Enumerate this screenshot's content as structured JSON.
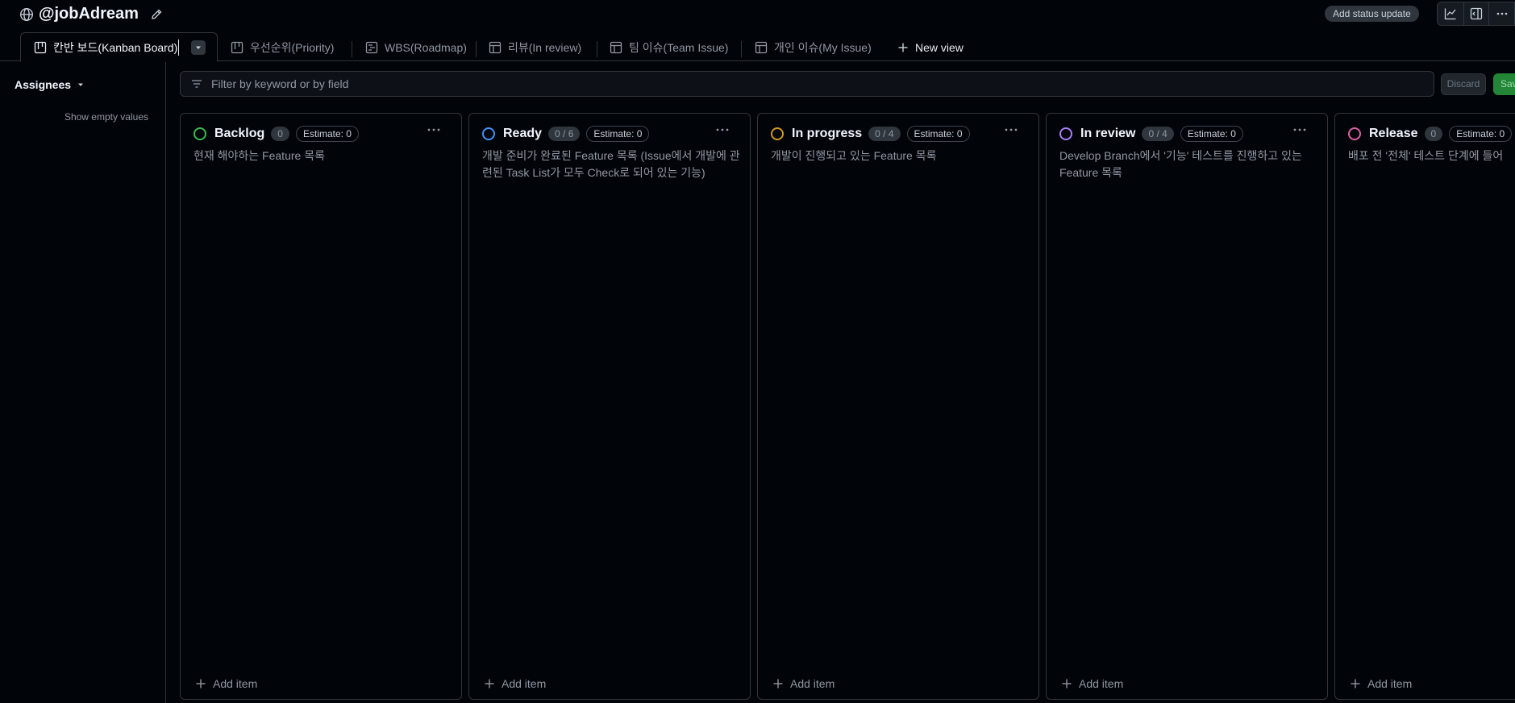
{
  "project": {
    "title": "@jobAdream"
  },
  "header": {
    "status_label": "Add status update"
  },
  "tabs": [
    {
      "label": "칸반 보드(Kanban Board)",
      "active": true,
      "icon": "board-icon"
    },
    {
      "label": "우선순위(Priority)",
      "icon": "board-icon"
    },
    {
      "label": "WBS(Roadmap)",
      "icon": "roadmap-icon"
    },
    {
      "label": "리뷰(In review)",
      "icon": "table-icon"
    },
    {
      "label": "팀 이슈(Team Issue)",
      "icon": "table-icon"
    },
    {
      "label": "개인 이슈(My Issue)",
      "icon": "table-icon"
    }
  ],
  "new_view_label": "New view",
  "sidebar": {
    "group_by": "Assignees",
    "empty_toggle": "Show empty values"
  },
  "filter": {
    "placeholder": "Filter by keyword or by field",
    "discard_label": "Discard",
    "save_label": "Save"
  },
  "columns": [
    {
      "title": "Backlog",
      "count": "0",
      "estimate": "Estimate: 0",
      "color": "#3fb950",
      "description": "현재 해야하는 Feature 목록",
      "add_label": "Add item"
    },
    {
      "title": "Ready",
      "count": "0 / 6",
      "estimate": "Estimate: 0",
      "color": "#4493f8",
      "description": "개발 준비가 완료된 Feature 목록 (Issue에서 개발에 관련된 Task List가 모두 Check로 되어 있는 기능)",
      "add_label": "Add item"
    },
    {
      "title": "In progress",
      "count": "0 / 4",
      "estimate": "Estimate: 0",
      "color": "#d29922",
      "description": "개발이 진행되고 있는 Feature 목록",
      "add_label": "Add item"
    },
    {
      "title": "In review",
      "count": "0 / 4",
      "estimate": "Estimate: 0",
      "color": "#ab7df8",
      "description": "Develop Branch에서 '기능' 테스트를 진행하고 있는 Feature 목록",
      "add_label": "Add item"
    },
    {
      "title": "Release",
      "count": "0",
      "estimate": "Estimate: 0",
      "color": "#db61a2",
      "description": "배포 전 '전체' 테스트 단계에 들어",
      "add_label": "Add item"
    }
  ]
}
